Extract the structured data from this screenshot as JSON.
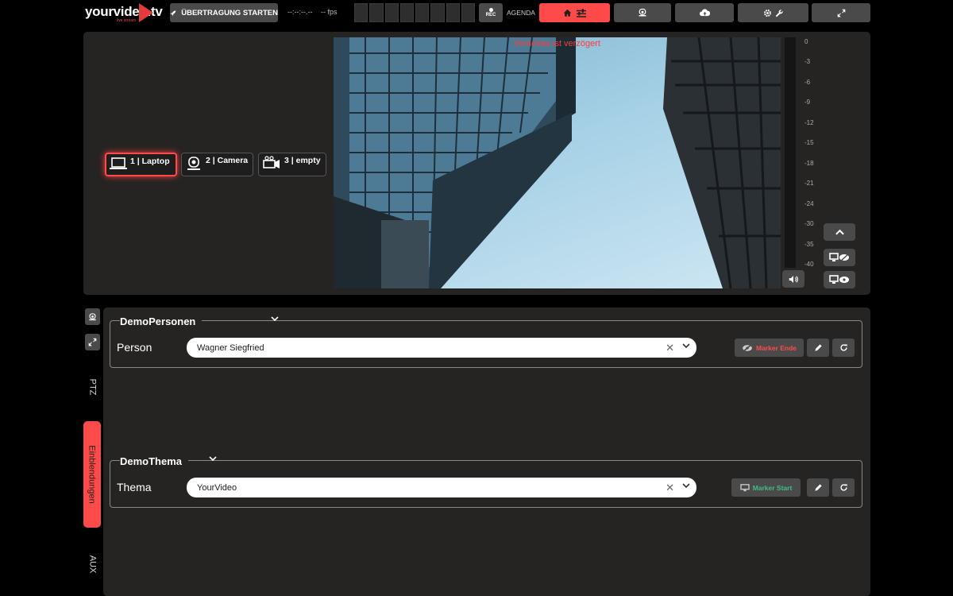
{
  "brand": {
    "name": "yourvideo.tv",
    "tagline": "live stream"
  },
  "topbar": {
    "start_label": "ÜBERTRAGUNG STARTEN",
    "timer": "--:--:--.--",
    "fps": "-- fps",
    "rec_label": "REC",
    "agenda_label": "AGENDA"
  },
  "preview": {
    "warning": "Vorschau ist verzögert",
    "vu_ticks": [
      "0",
      "-3",
      "-6",
      "-9",
      "-12",
      "-15",
      "-18",
      "-21",
      "-24",
      "-30",
      "-35",
      "-40"
    ]
  },
  "sources": [
    {
      "label": "1 | Laptop",
      "icon": "laptop-icon",
      "active": true
    },
    {
      "label": "2 | Camera",
      "icon": "ptz-camera-icon",
      "active": false
    },
    {
      "label": "3 | empty",
      "icon": "video-camera-icon",
      "active": false
    }
  ],
  "side_tabs": {
    "ptz": "PTZ",
    "overlays": "Einblendungen",
    "aux": "AUX"
  },
  "groups": [
    {
      "title": "DemoPersonen",
      "field_label": "Person",
      "value": "Wagner Siegfried",
      "marker_label": "Marker Ende",
      "marker_color": "#ff4a4a"
    },
    {
      "title": "DemoThema",
      "field_label": "Thema",
      "value": "YourVideo",
      "marker_label": "Marker Start",
      "marker_color": "#3fbf7f"
    }
  ],
  "colors": {
    "accent": "#ff4a4a",
    "panel": "#252423",
    "button": "#4a4a4a"
  }
}
